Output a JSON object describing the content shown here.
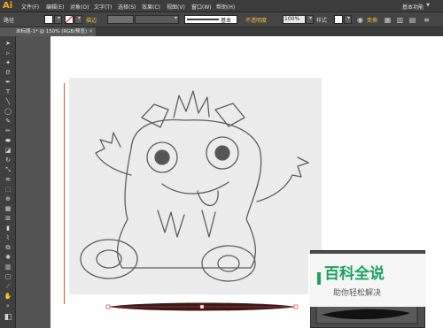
{
  "app": {
    "logo": "Ai",
    "workspace": "基本功能"
  },
  "menu": [
    "文件(F)",
    "编辑(E)",
    "对象(O)",
    "文字(T)",
    "选择(S)",
    "效果(C)",
    "视图(V)",
    "窗口(W)",
    "帮助(H)"
  ],
  "control": {
    "selection_label": "路径",
    "stroke_label": "描边",
    "brush_label": "基本",
    "opacity_label": "不透明度",
    "opacity_value": "100%",
    "style_label": "样式",
    "transform_label": "变换"
  },
  "document": {
    "tab_label": "未标题-1* @ 150% (RGB/预览)"
  },
  "watermark": {
    "title": "百科全说",
    "subtitle": "助你轻松解决"
  },
  "colors": {
    "accent": "#f7a51c",
    "guide": "#e05040",
    "watermark": "#1aa260"
  }
}
